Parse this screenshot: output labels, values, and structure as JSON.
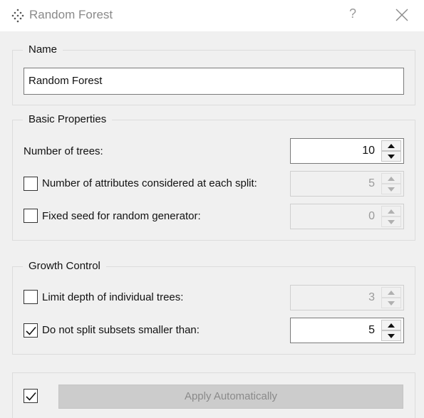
{
  "window": {
    "title": "Random Forest",
    "help_glyph": "?",
    "app_icon": "orange-random-forest-icon",
    "close_icon": "close-icon"
  },
  "name_group": {
    "title": "Name",
    "value": "Random Forest"
  },
  "basic": {
    "title": "Basic Properties",
    "trees_label": "Number of trees:",
    "trees_value": "10",
    "attributes_label": "Number of attributes considered at each split:",
    "attributes_checked": false,
    "attributes_value": "5",
    "seed_label": "Fixed seed for random generator:",
    "seed_checked": false,
    "seed_value": "0"
  },
  "growth": {
    "title": "Growth Control",
    "depth_label": "Limit depth of individual trees:",
    "depth_checked": false,
    "depth_value": "3",
    "split_label": "Do not split subsets smaller than:",
    "split_checked": true,
    "split_value": "5"
  },
  "footer": {
    "auto_checked": true,
    "apply_label": "Apply Automatically"
  },
  "colors": {
    "background": "#f0f0f0",
    "disabled_text": "#9a9a9a",
    "button_disabled": "#cccccc"
  }
}
